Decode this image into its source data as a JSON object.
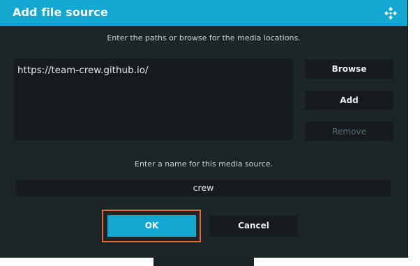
{
  "dialog": {
    "title": "Add file source",
    "logo_icon": "kodi-logo-icon",
    "paths_instruction": "Enter the paths or browse for the media locations.",
    "paths": [
      "https://team-crew.github.io/"
    ],
    "buttons": {
      "browse": "Browse",
      "add": "Add",
      "remove": "Remove"
    },
    "name_instruction": "Enter a name for this media source.",
    "name_value": "crew",
    "ok": "OK",
    "cancel": "Cancel"
  },
  "colors": {
    "accent": "#12a8d2",
    "dialog_bg": "#1d2528",
    "field_bg": "#151b1e",
    "highlight": "#e06a3b"
  }
}
